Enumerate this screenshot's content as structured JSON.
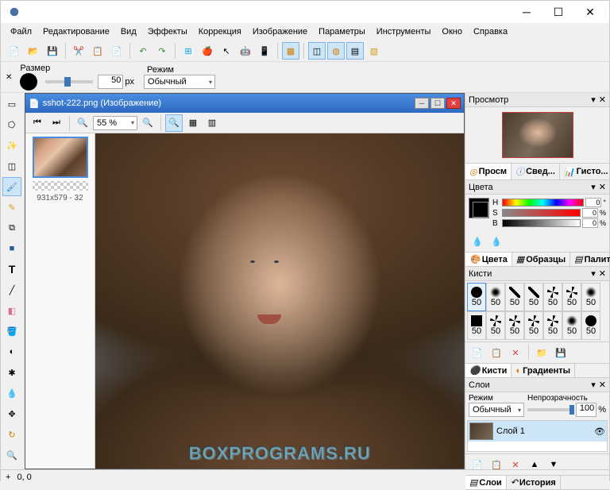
{
  "menubar": [
    "Файл",
    "Редактирование",
    "Вид",
    "Эффекты",
    "Коррекция",
    "Изображение",
    "Параметры",
    "Инструменты",
    "Окно",
    "Справка"
  ],
  "toolbar2": {
    "size_label": "Размер",
    "size_value": "50",
    "size_unit": "px",
    "mode_label": "Режим",
    "mode_value": "Обычный"
  },
  "document": {
    "title": "sshot-222.png (Изображение)",
    "zoom": "55 %",
    "thumb_caption": "931x579 - 32",
    "watermark": "BOXPROGRAMS.RU"
  },
  "panels": {
    "preview": {
      "title": "Просмотр",
      "tab1": "Просм",
      "tab2": "Свед...",
      "tab3": "Гисто..."
    },
    "colors": {
      "title": "Цвета",
      "H": "0",
      "S": "0",
      "B": "0",
      "deg": "°",
      "pct": "%",
      "tab1": "Цвета",
      "tab2": "Образцы",
      "tab3": "Палитра"
    },
    "brushes": {
      "title": "Кисти",
      "size": "50",
      "tab1": "Кисти",
      "tab2": "Градиенты"
    },
    "layers": {
      "title": "Слои",
      "mode_label": "Режим",
      "mode_value": "Обычный",
      "opacity_label": "Непрозрачность",
      "opacity_value": "100",
      "pct": "%",
      "layer1": "Слой 1",
      "tab1": "Слои",
      "tab2": "История"
    }
  },
  "status": {
    "coords": "0, 0",
    "up": "+"
  }
}
